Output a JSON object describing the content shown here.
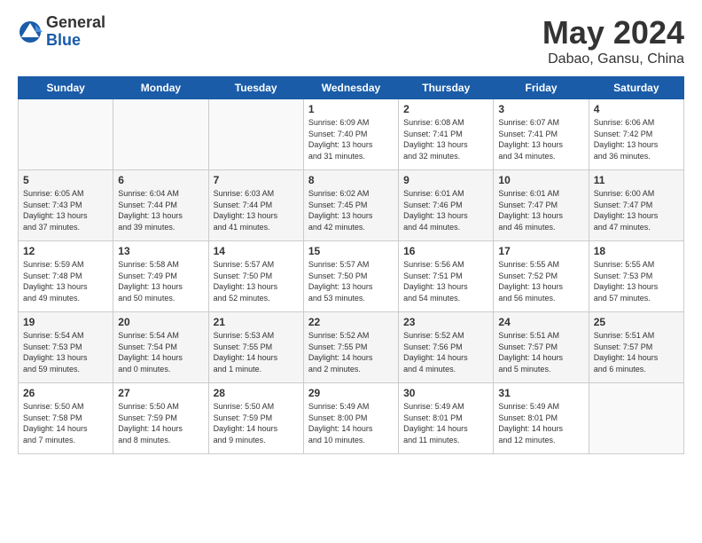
{
  "logo": {
    "general": "General",
    "blue": "Blue"
  },
  "header": {
    "month": "May 2024",
    "location": "Dabao, Gansu, China"
  },
  "weekdays": [
    "Sunday",
    "Monday",
    "Tuesday",
    "Wednesday",
    "Thursday",
    "Friday",
    "Saturday"
  ],
  "weeks": [
    [
      {
        "day": "",
        "info": ""
      },
      {
        "day": "",
        "info": ""
      },
      {
        "day": "",
        "info": ""
      },
      {
        "day": "1",
        "info": "Sunrise: 6:09 AM\nSunset: 7:40 PM\nDaylight: 13 hours\nand 31 minutes."
      },
      {
        "day": "2",
        "info": "Sunrise: 6:08 AM\nSunset: 7:41 PM\nDaylight: 13 hours\nand 32 minutes."
      },
      {
        "day": "3",
        "info": "Sunrise: 6:07 AM\nSunset: 7:41 PM\nDaylight: 13 hours\nand 34 minutes."
      },
      {
        "day": "4",
        "info": "Sunrise: 6:06 AM\nSunset: 7:42 PM\nDaylight: 13 hours\nand 36 minutes."
      }
    ],
    [
      {
        "day": "5",
        "info": "Sunrise: 6:05 AM\nSunset: 7:43 PM\nDaylight: 13 hours\nand 37 minutes."
      },
      {
        "day": "6",
        "info": "Sunrise: 6:04 AM\nSunset: 7:44 PM\nDaylight: 13 hours\nand 39 minutes."
      },
      {
        "day": "7",
        "info": "Sunrise: 6:03 AM\nSunset: 7:44 PM\nDaylight: 13 hours\nand 41 minutes."
      },
      {
        "day": "8",
        "info": "Sunrise: 6:02 AM\nSunset: 7:45 PM\nDaylight: 13 hours\nand 42 minutes."
      },
      {
        "day": "9",
        "info": "Sunrise: 6:01 AM\nSunset: 7:46 PM\nDaylight: 13 hours\nand 44 minutes."
      },
      {
        "day": "10",
        "info": "Sunrise: 6:01 AM\nSunset: 7:47 PM\nDaylight: 13 hours\nand 46 minutes."
      },
      {
        "day": "11",
        "info": "Sunrise: 6:00 AM\nSunset: 7:47 PM\nDaylight: 13 hours\nand 47 minutes."
      }
    ],
    [
      {
        "day": "12",
        "info": "Sunrise: 5:59 AM\nSunset: 7:48 PM\nDaylight: 13 hours\nand 49 minutes."
      },
      {
        "day": "13",
        "info": "Sunrise: 5:58 AM\nSunset: 7:49 PM\nDaylight: 13 hours\nand 50 minutes."
      },
      {
        "day": "14",
        "info": "Sunrise: 5:57 AM\nSunset: 7:50 PM\nDaylight: 13 hours\nand 52 minutes."
      },
      {
        "day": "15",
        "info": "Sunrise: 5:57 AM\nSunset: 7:50 PM\nDaylight: 13 hours\nand 53 minutes."
      },
      {
        "day": "16",
        "info": "Sunrise: 5:56 AM\nSunset: 7:51 PM\nDaylight: 13 hours\nand 54 minutes."
      },
      {
        "day": "17",
        "info": "Sunrise: 5:55 AM\nSunset: 7:52 PM\nDaylight: 13 hours\nand 56 minutes."
      },
      {
        "day": "18",
        "info": "Sunrise: 5:55 AM\nSunset: 7:53 PM\nDaylight: 13 hours\nand 57 minutes."
      }
    ],
    [
      {
        "day": "19",
        "info": "Sunrise: 5:54 AM\nSunset: 7:53 PM\nDaylight: 13 hours\nand 59 minutes."
      },
      {
        "day": "20",
        "info": "Sunrise: 5:54 AM\nSunset: 7:54 PM\nDaylight: 14 hours\nand 0 minutes."
      },
      {
        "day": "21",
        "info": "Sunrise: 5:53 AM\nSunset: 7:55 PM\nDaylight: 14 hours\nand 1 minute."
      },
      {
        "day": "22",
        "info": "Sunrise: 5:52 AM\nSunset: 7:55 PM\nDaylight: 14 hours\nand 2 minutes."
      },
      {
        "day": "23",
        "info": "Sunrise: 5:52 AM\nSunset: 7:56 PM\nDaylight: 14 hours\nand 4 minutes."
      },
      {
        "day": "24",
        "info": "Sunrise: 5:51 AM\nSunset: 7:57 PM\nDaylight: 14 hours\nand 5 minutes."
      },
      {
        "day": "25",
        "info": "Sunrise: 5:51 AM\nSunset: 7:57 PM\nDaylight: 14 hours\nand 6 minutes."
      }
    ],
    [
      {
        "day": "26",
        "info": "Sunrise: 5:50 AM\nSunset: 7:58 PM\nDaylight: 14 hours\nand 7 minutes."
      },
      {
        "day": "27",
        "info": "Sunrise: 5:50 AM\nSunset: 7:59 PM\nDaylight: 14 hours\nand 8 minutes."
      },
      {
        "day": "28",
        "info": "Sunrise: 5:50 AM\nSunset: 7:59 PM\nDaylight: 14 hours\nand 9 minutes."
      },
      {
        "day": "29",
        "info": "Sunrise: 5:49 AM\nSunset: 8:00 PM\nDaylight: 14 hours\nand 10 minutes."
      },
      {
        "day": "30",
        "info": "Sunrise: 5:49 AM\nSunset: 8:01 PM\nDaylight: 14 hours\nand 11 minutes."
      },
      {
        "day": "31",
        "info": "Sunrise: 5:49 AM\nSunset: 8:01 PM\nDaylight: 14 hours\nand 12 minutes."
      },
      {
        "day": "",
        "info": ""
      }
    ]
  ]
}
